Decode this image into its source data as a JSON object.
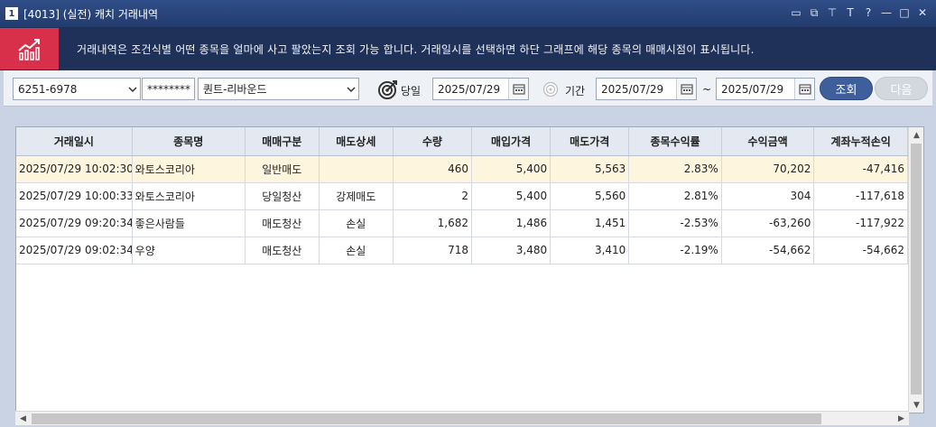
{
  "window": {
    "number": "1",
    "title": "[4013] (실전) 캐치 거래내역",
    "controls": [
      "▭",
      "⧉",
      "⊤",
      "T",
      "?",
      "—",
      "□",
      "✕"
    ]
  },
  "banner": {
    "text": "거래내역은 조건식별 어떤 종목을 얼마에 사고 팔았는지 조회 가능 합니다. 거래일시를 선택하면 하단 그래프에 해당 종목의 매매시점이 표시됩니다."
  },
  "toolbar": {
    "account": "6251-6978",
    "password": "********",
    "strategy": "퀀트-리바운드",
    "today_label": "당일",
    "today_date": "2025/07/29",
    "period_label": "기간",
    "from_date": "2025/07/29",
    "tilde": "~",
    "to_date": "2025/07/29",
    "query_label": "조회",
    "next_label": "다음"
  },
  "table": {
    "headers": [
      "거래일시",
      "종목명",
      "매매구분",
      "매도상세",
      "수량",
      "매입가격",
      "매도가격",
      "종목수익률",
      "수익금액",
      "계좌누적손익"
    ],
    "rows": [
      [
        "2025/07/29 10:02:30",
        "와토스코리아",
        "일반매도",
        "",
        "460",
        "5,400",
        "5,563",
        "2.83%",
        "70,202",
        "-47,416"
      ],
      [
        "2025/07/29 10:00:33",
        "와토스코리아",
        "당일청산",
        "강제매도",
        "2",
        "5,400",
        "5,560",
        "2.81%",
        "304",
        "-117,618"
      ],
      [
        "2025/07/29 09:20:34",
        "좋은사람들",
        "매도청산",
        "손실",
        "1,682",
        "1,486",
        "1,451",
        "-2.53%",
        "-63,260",
        "-117,922"
      ],
      [
        "2025/07/29 09:02:34",
        "우양",
        "매도청산",
        "손실",
        "718",
        "3,480",
        "3,410",
        "-2.19%",
        "-54,662",
        "-54,662"
      ]
    ]
  }
}
